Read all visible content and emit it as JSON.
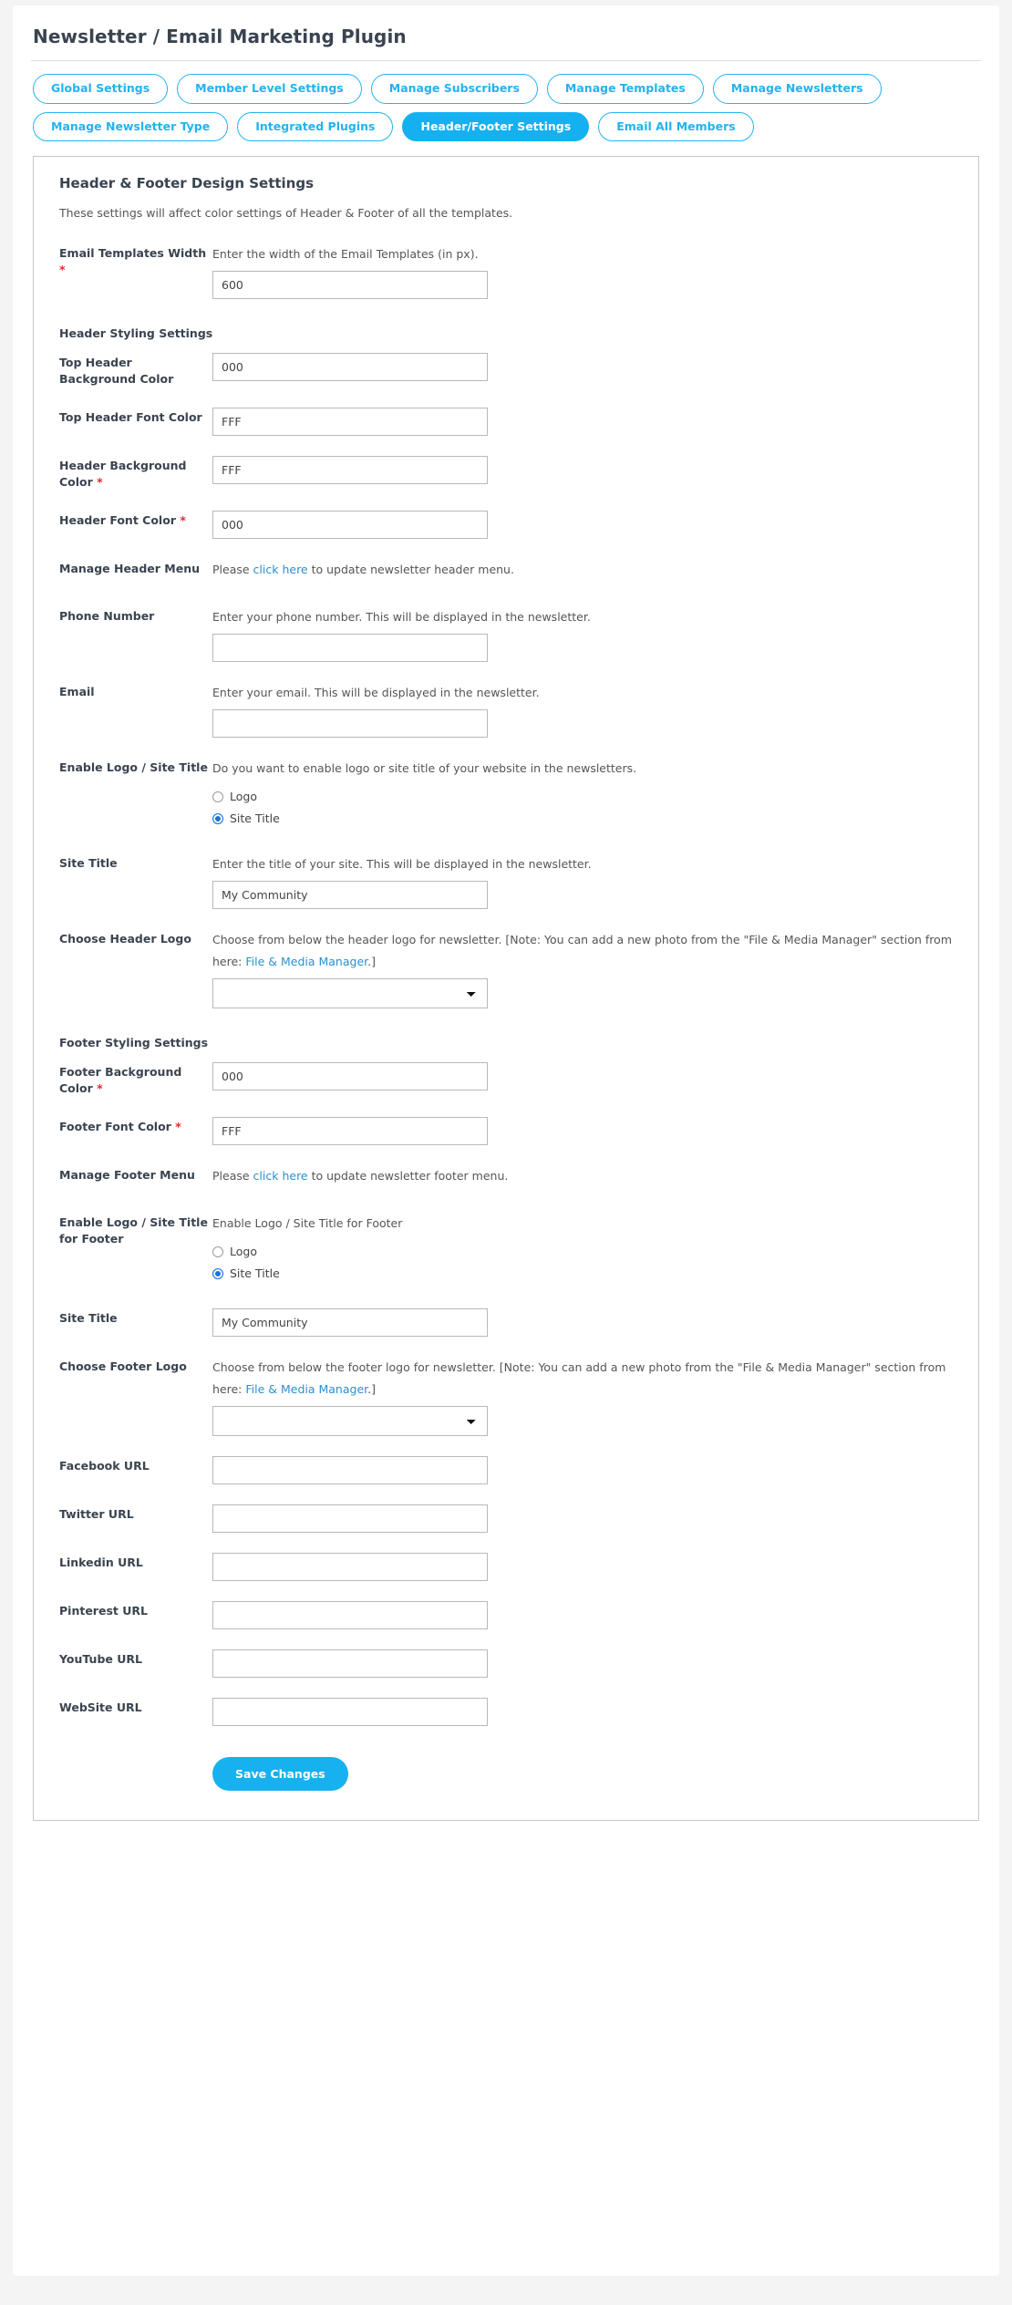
{
  "header": {
    "title": "Newsletter / Email Marketing Plugin"
  },
  "tabs": [
    {
      "label": "Global Settings",
      "active": false
    },
    {
      "label": "Member Level Settings",
      "active": false
    },
    {
      "label": "Manage Subscribers",
      "active": false
    },
    {
      "label": "Manage Templates",
      "active": false
    },
    {
      "label": "Manage Newsletters",
      "active": false
    },
    {
      "label": "Manage Newsletter Type",
      "active": false
    },
    {
      "label": "Integrated Plugins",
      "active": false
    },
    {
      "label": "Header/Footer Settings",
      "active": true
    },
    {
      "label": "Email All Members",
      "active": false
    }
  ],
  "panel": {
    "title": "Header & Footer Design Settings",
    "description": "These settings will affect color settings of Header & Footer of all the templates."
  },
  "sections": {
    "header_styling": "Header Styling Settings",
    "footer_styling": "Footer Styling Settings"
  },
  "fields": {
    "email_templates_width": {
      "label": "Email Templates Width",
      "required": true,
      "help": "Enter the width of the Email Templates (in px).",
      "value": "600"
    },
    "top_header_bg_color": {
      "label": "Top Header Background Color",
      "required": false,
      "value": "000"
    },
    "top_header_font_color": {
      "label": "Top Header Font Color",
      "required": false,
      "value": "FFF"
    },
    "header_bg_color": {
      "label": "Header Background Color",
      "required": true,
      "value": "FFF"
    },
    "header_font_color": {
      "label": "Header Font Color",
      "required": true,
      "value": "000"
    },
    "manage_header_menu": {
      "label": "Manage Header Menu",
      "help_pre": "Please ",
      "help_link": "click here",
      "help_post": " to update newsletter header menu."
    },
    "phone_number": {
      "label": "Phone Number",
      "help": "Enter your phone number. This will be displayed in the newsletter.",
      "value": ""
    },
    "email": {
      "label": "Email",
      "help": "Enter your email. This will be displayed in the newsletter.",
      "value": ""
    },
    "enable_logo_site_title": {
      "label": "Enable Logo / Site Title",
      "help": "Do you want to enable logo or site title of your website in the newsletters.",
      "options": [
        {
          "label": "Logo",
          "checked": false
        },
        {
          "label": "Site Title",
          "checked": true
        }
      ]
    },
    "site_title_header": {
      "label": "Site Title",
      "help": "Enter the title of your site. This will be displayed in the newsletter.",
      "value": "My Community"
    },
    "choose_header_logo": {
      "label": "Choose Header Logo",
      "help_pre": "Choose from below the header logo for newsletter. [Note: You can add a new photo from the \"File & Media Manager\" section from here: ",
      "help_link": "File & Media Manager",
      "help_post": ".]",
      "selected": ""
    },
    "footer_bg_color": {
      "label": "Footer Background Color",
      "required": true,
      "value": "000"
    },
    "footer_font_color": {
      "label": "Footer Font Color",
      "required": true,
      "value": "FFF"
    },
    "manage_footer_menu": {
      "label": "Manage Footer Menu",
      "help_pre": "Please ",
      "help_link": "click here",
      "help_post": " to update newsletter footer menu."
    },
    "enable_logo_site_title_footer": {
      "label": "Enable Logo / Site Title for Footer",
      "help": "Enable Logo / Site Title for Footer",
      "options": [
        {
          "label": "Logo",
          "checked": false
        },
        {
          "label": "Site Title",
          "checked": true
        }
      ]
    },
    "site_title_footer": {
      "label": "Site Title",
      "value": "My Community"
    },
    "choose_footer_logo": {
      "label": "Choose Footer Logo",
      "help_pre": "Choose from below the footer logo for newsletter. [Note: You can add a new photo from the \"File & Media Manager\" section from here: ",
      "help_link": "File & Media Manager",
      "help_post": ".]",
      "selected": ""
    },
    "facebook_url": {
      "label": "Facebook URL",
      "value": ""
    },
    "twitter_url": {
      "label": "Twitter URL",
      "value": ""
    },
    "linkedin_url": {
      "label": "Linkedin URL",
      "value": ""
    },
    "pinterest_url": {
      "label": "Pinterest URL",
      "value": ""
    },
    "youtube_url": {
      "label": "YouTube URL",
      "value": ""
    },
    "website_url": {
      "label": "WebSite URL",
      "value": ""
    }
  },
  "actions": {
    "save_label": "Save Changes"
  },
  "colors": {
    "accent": "#15b0f0",
    "link": "#2b8fd0",
    "required": "#e02b2b",
    "radio_checked": "#1a73d8"
  }
}
